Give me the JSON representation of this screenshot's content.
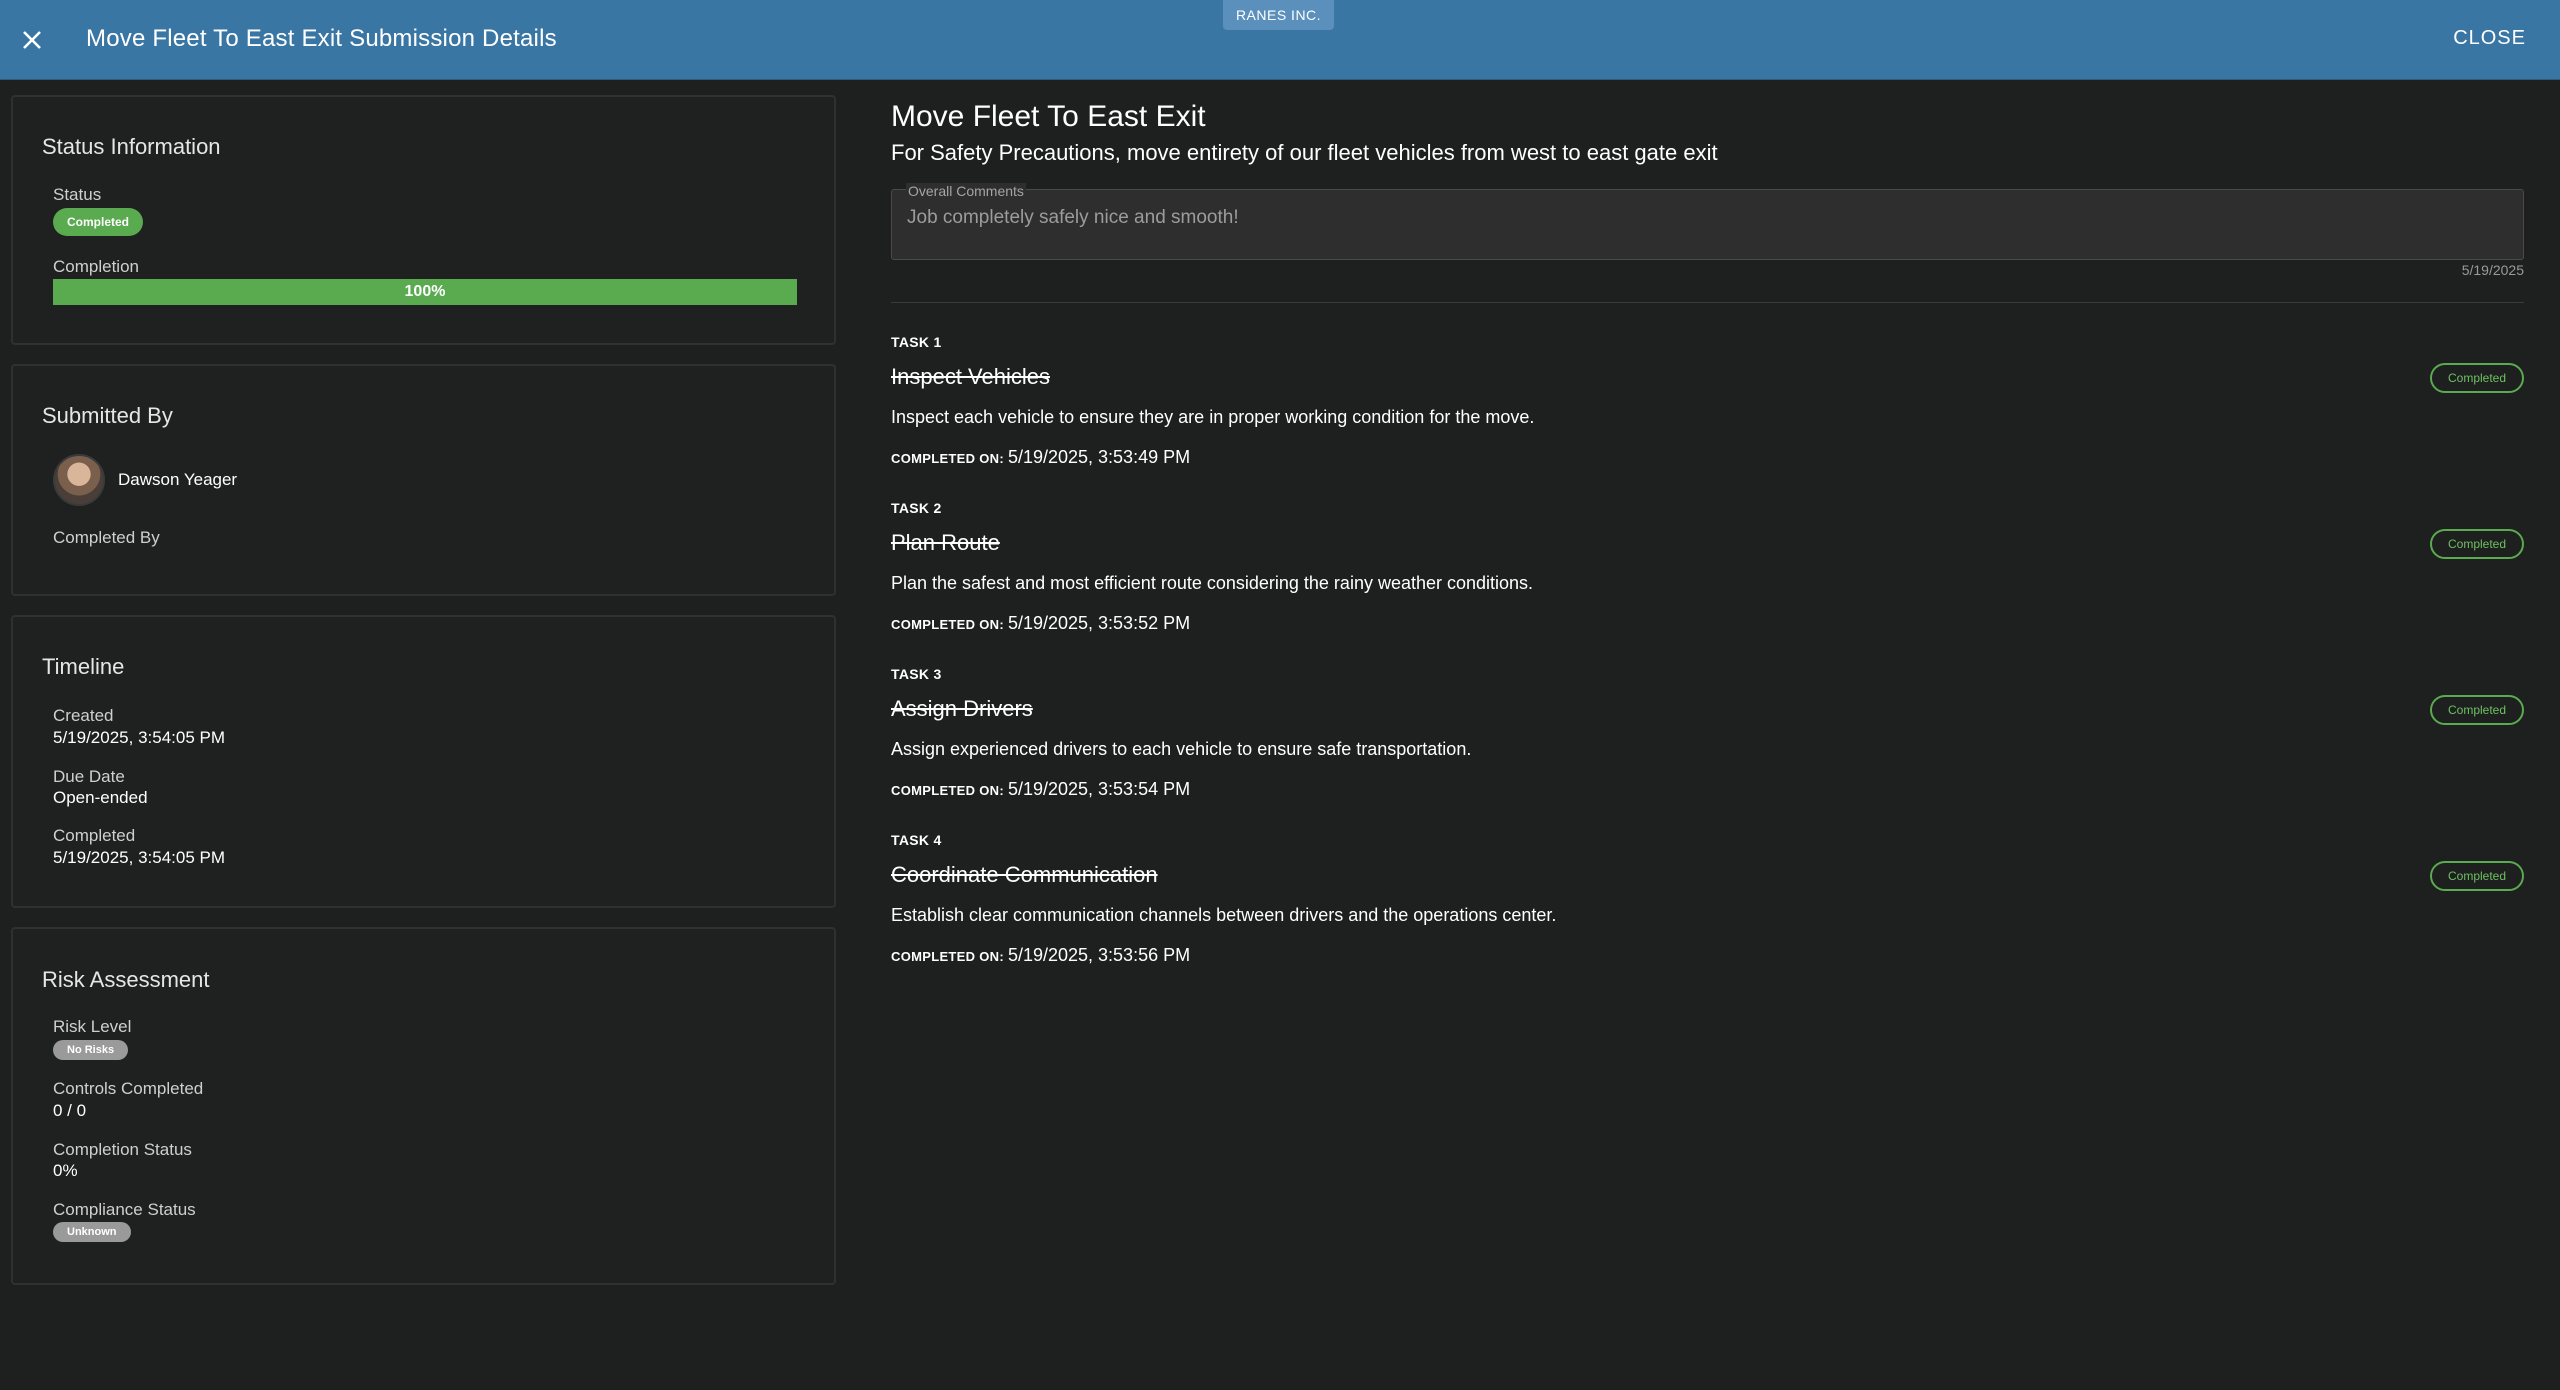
{
  "header": {
    "title": "Move Fleet To East Exit Submission Details",
    "org": "RANES INC.",
    "close_label": "CLOSE"
  },
  "status_card": {
    "title": "Status Information",
    "status_label": "Status",
    "status_value": "Completed",
    "completion_label": "Completion",
    "completion_value": "100%",
    "completion_fraction": 1.0
  },
  "submitted_card": {
    "title": "Submitted By",
    "user_name": "Dawson Yeager",
    "completed_by_label": "Completed By"
  },
  "timeline_card": {
    "title": "Timeline",
    "created_label": "Created",
    "created_value": "5/19/2025, 3:54:05 PM",
    "due_label": "Due Date",
    "due_value": "Open-ended",
    "completed_label": "Completed",
    "completed_value": "5/19/2025, 3:54:05 PM"
  },
  "risk_card": {
    "title": "Risk Assessment",
    "risk_level_label": "Risk Level",
    "risk_level_value": "No Risks",
    "controls_label": "Controls Completed",
    "controls_value": "0 / 0",
    "completion_status_label": "Completion Status",
    "completion_status_value": "0%",
    "compliance_label": "Compliance Status",
    "compliance_value": "Unknown"
  },
  "main": {
    "title": "Move Fleet To East Exit",
    "subtitle": "For Safety Precautions, move entirety of our fleet vehicles from west to east gate exit",
    "comments_label": "Overall Comments",
    "comments_value": "Job completely safely nice and smooth!",
    "comments_date": "5/19/2025"
  },
  "tasks": [
    {
      "num": "TASK 1",
      "title": "Inspect Vehicles",
      "desc": "Inspect each vehicle to ensure they are in proper working condition for the move.",
      "completed_on_label": "COMPLETED ON:",
      "completed_on": "5/19/2025, 3:53:49 PM",
      "status": "Completed"
    },
    {
      "num": "TASK 2",
      "title": "Plan Route",
      "desc": "Plan the safest and most efficient route considering the rainy weather conditions.",
      "completed_on_label": "COMPLETED ON:",
      "completed_on": "5/19/2025, 3:53:52 PM",
      "status": "Completed"
    },
    {
      "num": "TASK 3",
      "title": "Assign Drivers",
      "desc": "Assign experienced drivers to each vehicle to ensure safe transportation.",
      "completed_on_label": "COMPLETED ON:",
      "completed_on": "5/19/2025, 3:53:54 PM",
      "status": "Completed"
    },
    {
      "num": "TASK 4",
      "title": "Coordinate Communication",
      "desc": "Establish clear communication channels between drivers and the operations center.",
      "completed_on_label": "COMPLETED ON:",
      "completed_on": "5/19/2025, 3:53:56 PM",
      "status": "Completed"
    }
  ],
  "colors": {
    "header_bg": "#3a76a4",
    "accent_green": "#5aaa4f",
    "page_bg": "#1e1f1f"
  }
}
